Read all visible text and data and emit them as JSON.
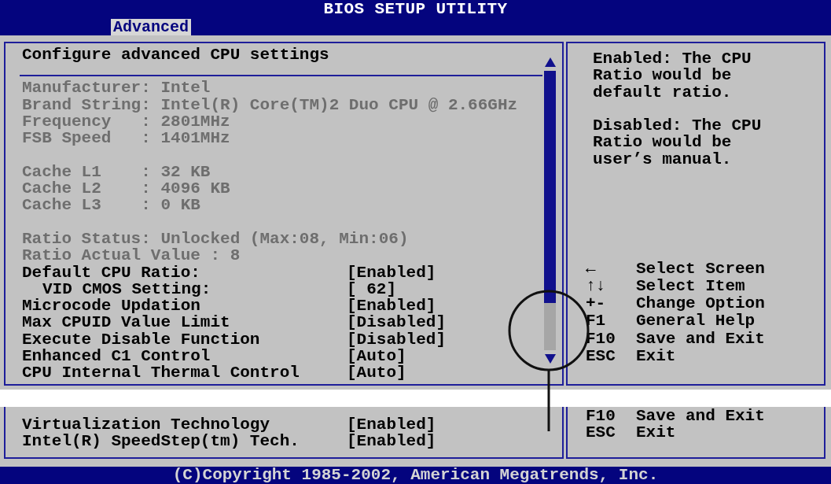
{
  "title": "BIOS SETUP UTILITY",
  "tabs": [
    {
      "label": "Advanced",
      "selected": true
    }
  ],
  "settings_panel": {
    "heading": "Configure advanced CPU settings",
    "cpu_info": [
      {
        "lines": [
          "Manufacturer: Intel",
          "Brand String: Intel(R) Core(TM)2 Duo CPU @ 2.66GHz",
          "Frequency   : 2801MHz",
          "FSB Speed   : 1401MHz"
        ]
      },
      {
        "lines": [
          "Cache L1    : 32 KB",
          "Cache L2    : 4096 KB",
          "Cache L3    : 0 KB"
        ]
      },
      {
        "lines": [
          "Ratio Status: Unlocked (Max:08, Min:06)",
          "Ratio Actual Value : 8"
        ]
      }
    ],
    "options": [
      {
        "label": "Default CPU Ratio:",
        "value": "[Enabled]",
        "children": [
          {
            "label": "VID CMOS Setting:",
            "value": "[ 62]"
          }
        ]
      },
      {
        "label": "Microcode Updation",
        "value": "[Enabled]"
      },
      {
        "label": "Max CPUID Value Limit",
        "value": "[Disabled]"
      },
      {
        "label": "Execute Disable Function",
        "value": "[Disabled]"
      },
      {
        "label": "Enhanced C1 Control",
        "value": "[Auto]"
      },
      {
        "label": "CPU Internal Thermal Control",
        "value": "[Auto]"
      }
    ]
  },
  "help_panel": {
    "paragraphs": [
      "Enabled: The CPU Ratio would be default ratio.",
      "Disabled: The CPU Ratio would be user’s manual."
    ],
    "keys": [
      {
        "key": "←",
        "action": "Select Screen"
      },
      {
        "key": "↑↓",
        "action": "Select Item"
      },
      {
        "key": "+-",
        "action": "Change Option"
      },
      {
        "key": "F1",
        "action": "General Help"
      },
      {
        "key": "F10",
        "action": "Save and Exit"
      },
      {
        "key": "ESC",
        "action": "Exit"
      }
    ]
  },
  "continued_view": {
    "options": [
      {
        "label": "Virtualization Technology",
        "value": "[Enabled]"
      },
      {
        "label": "Intel(R) SpeedStep(tm) Tech.",
        "value": "[Enabled]"
      }
    ],
    "keys": [
      {
        "key": "F10",
        "action": "Save and Exit"
      },
      {
        "key": "ESC",
        "action": "Exit"
      }
    ]
  },
  "copyright": "(C)Copyright 1985-2002, American Megatrends, Inc."
}
